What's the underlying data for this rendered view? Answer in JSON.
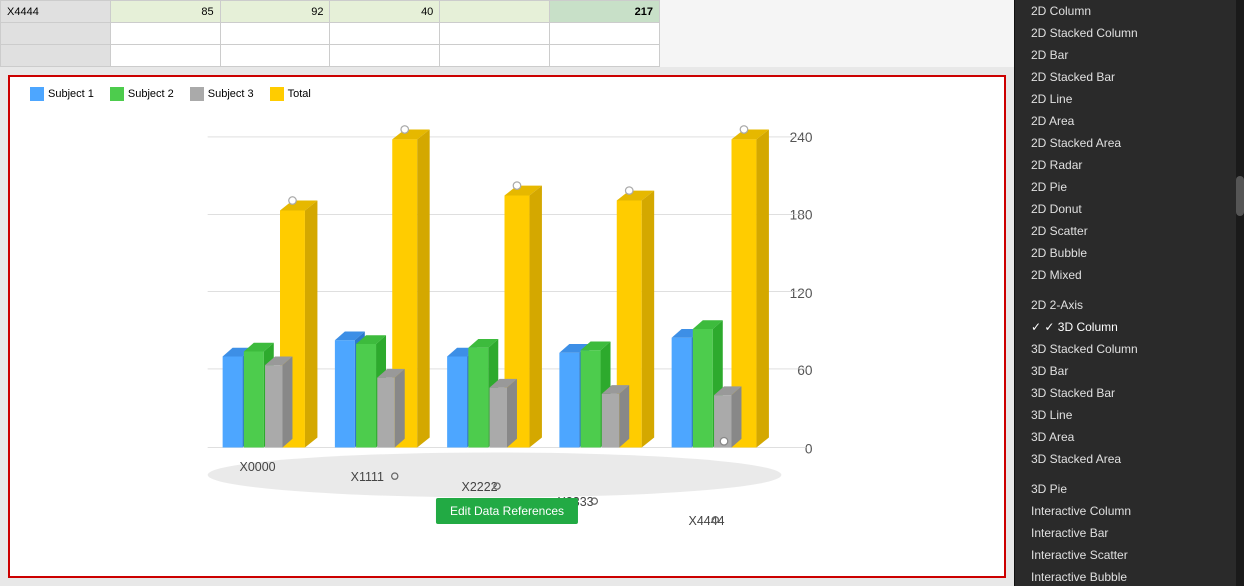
{
  "table": {
    "rows": [
      {
        "label": "X4444",
        "v1": "85",
        "v2": "92",
        "v3": "40",
        "v4": "",
        "total": "217"
      },
      {
        "label": "",
        "v1": "",
        "v2": "",
        "v3": "",
        "v4": "",
        "total": ""
      },
      {
        "label": "",
        "v1": "",
        "v2": "",
        "v3": "",
        "v4": "",
        "total": ""
      }
    ]
  },
  "chart": {
    "title": "",
    "legend": [
      {
        "label": "Subject 1",
        "color": "#4da6ff"
      },
      {
        "label": "Subject 2",
        "color": "#4dcc4d"
      },
      {
        "label": "Subject 3",
        "color": "#aaaaaa"
      },
      {
        "label": "Total",
        "color": "#ffcc00"
      }
    ],
    "yAxis": [
      "240",
      "180",
      "120",
      "60",
      "0"
    ],
    "xAxis": [
      "X0000",
      "X1111",
      "X2222",
      "X3333",
      "X4444"
    ],
    "editButton": "Edit Data References"
  },
  "sidebar": {
    "items": [
      {
        "label": "2D Column",
        "checked": false,
        "divider": false
      },
      {
        "label": "2D Stacked Column",
        "checked": false,
        "divider": false
      },
      {
        "label": "2D Bar",
        "checked": false,
        "divider": false
      },
      {
        "label": "2D Stacked Bar",
        "checked": false,
        "divider": false
      },
      {
        "label": "2D Line",
        "checked": false,
        "divider": false
      },
      {
        "label": "2D Area",
        "checked": false,
        "divider": false
      },
      {
        "label": "2D Stacked Area",
        "checked": false,
        "divider": false
      },
      {
        "label": "2D Radar",
        "checked": false,
        "divider": false
      },
      {
        "label": "2D Pie",
        "checked": false,
        "divider": false
      },
      {
        "label": "2D Donut",
        "checked": false,
        "divider": false
      },
      {
        "label": "2D Scatter",
        "checked": false,
        "divider": false
      },
      {
        "label": "2D Bubble",
        "checked": false,
        "divider": false
      },
      {
        "label": "2D Mixed",
        "checked": false,
        "divider": false
      },
      {
        "label": "2D 2-Axis",
        "checked": false,
        "divider": true
      },
      {
        "label": "3D Column",
        "checked": true,
        "divider": false
      },
      {
        "label": "3D Stacked Column",
        "checked": false,
        "divider": false
      },
      {
        "label": "3D Bar",
        "checked": false,
        "divider": false
      },
      {
        "label": "3D Stacked Bar",
        "checked": false,
        "divider": false
      },
      {
        "label": "3D Line",
        "checked": false,
        "divider": false
      },
      {
        "label": "3D Area",
        "checked": false,
        "divider": false
      },
      {
        "label": "3D Stacked Area",
        "checked": false,
        "divider": false
      },
      {
        "label": "3D Pie",
        "checked": false,
        "divider": true
      },
      {
        "label": "Interactive Column",
        "checked": false,
        "divider": false
      },
      {
        "label": "Interactive Bar",
        "checked": false,
        "divider": false
      },
      {
        "label": "Interactive Scatter",
        "checked": false,
        "divider": false
      },
      {
        "label": "Interactive Bubble",
        "checked": false,
        "divider": false
      }
    ]
  }
}
